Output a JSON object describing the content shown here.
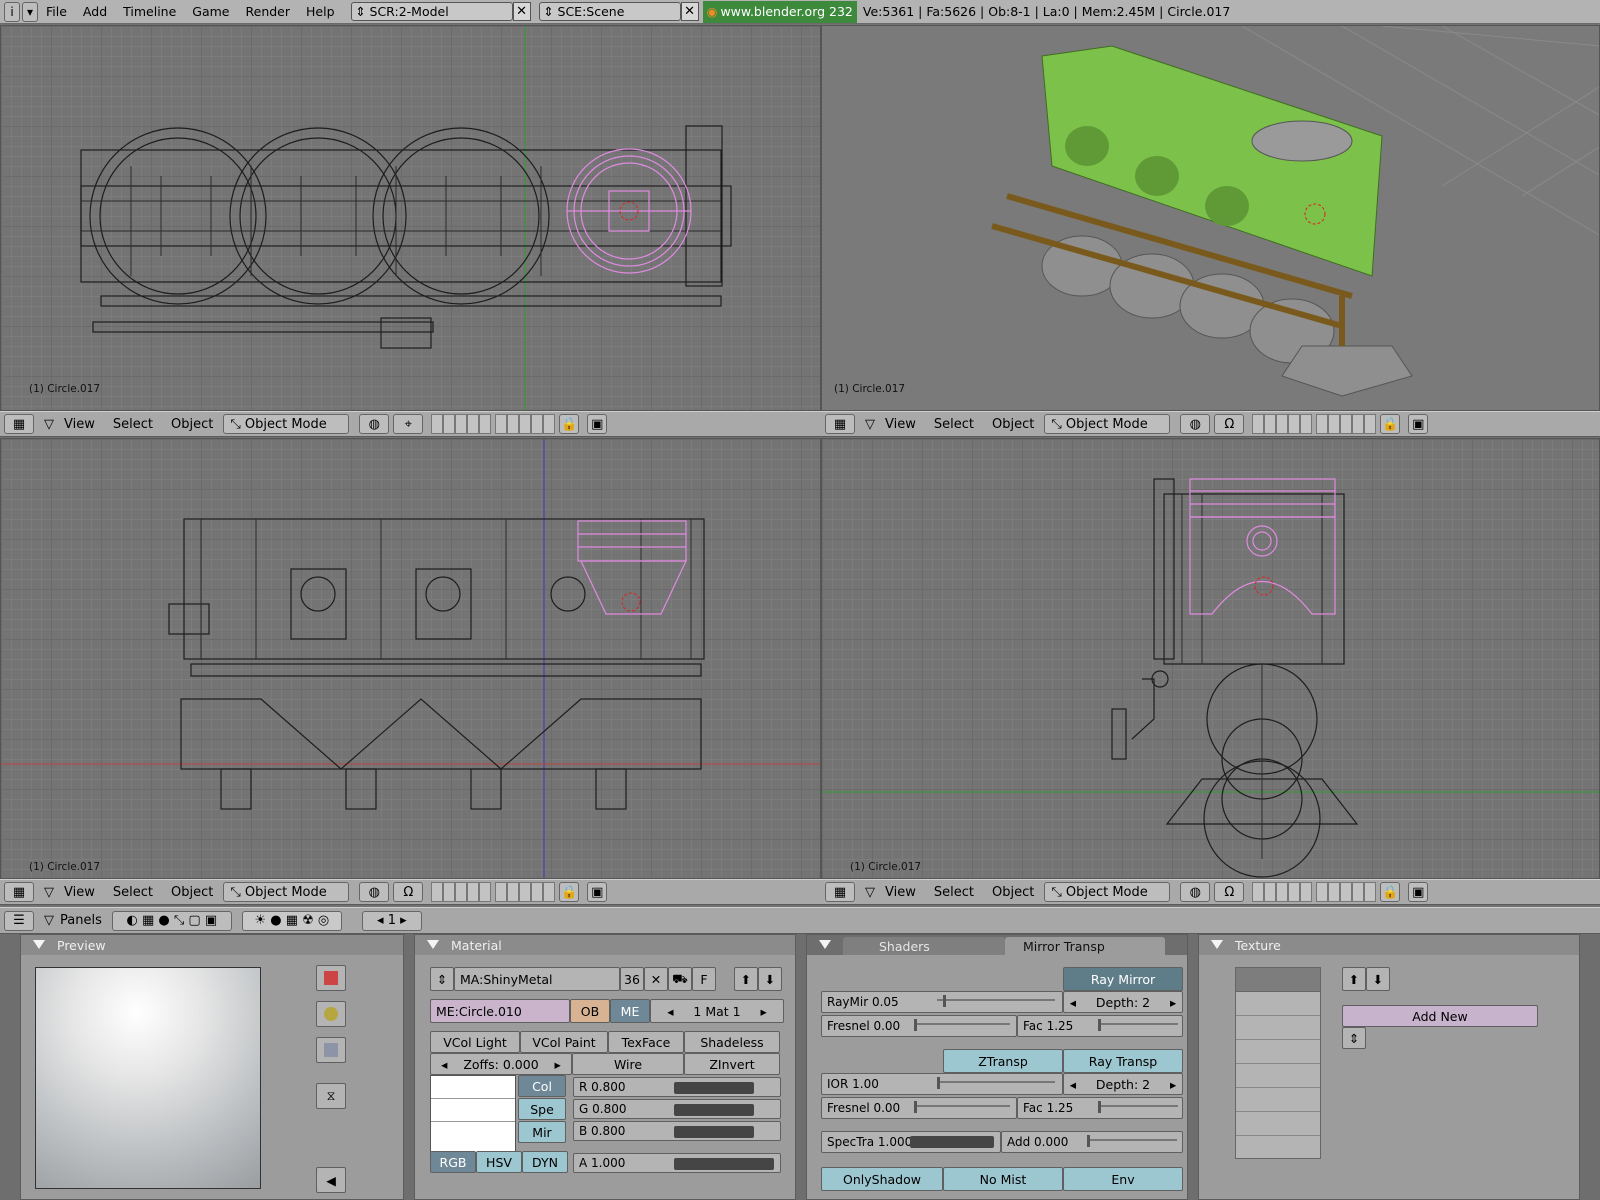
{
  "topbar": {
    "menus": [
      "File",
      "Add",
      "Timeline",
      "Game",
      "Render",
      "Help"
    ],
    "screen": "SCR:2-Model",
    "scene": "SCE:Scene",
    "website": "www.blender.org 232",
    "stats": "Ve:5361 | Fa:5626 | Ob:8-1 | La:0 | Mem:2.45M | Circle.017"
  },
  "viewports": {
    "label": "(1) Circle.017",
    "menus": [
      "View",
      "Select",
      "Object"
    ],
    "mode": "Object Mode"
  },
  "buttons_header": {
    "panels_label": "Panels",
    "frame": "1"
  },
  "preview": {
    "title": "Preview"
  },
  "material": {
    "title": "Material",
    "name": "MA:ShinyMetal",
    "users": "36",
    "f_label": "F",
    "mesh": "ME:Circle.010",
    "ob": "OB",
    "me": "ME",
    "mat_index": "1 Mat 1",
    "toggles": [
      "VCol Light",
      "VCol Paint",
      "TexFace",
      "Shadeless"
    ],
    "zoffs": "Zoffs: 0.000",
    "wire": "Wire",
    "zinvert": "ZInvert",
    "color_tabs": [
      "Col",
      "Spe",
      "Mir"
    ],
    "r": "R 0.800",
    "g": "G 0.800",
    "b": "B 0.800",
    "a": "A 1.000",
    "r_val": 0.8,
    "g_val": 0.8,
    "b_val": 0.8,
    "a_val": 1.0,
    "modes": [
      "RGB",
      "HSV",
      "DYN"
    ]
  },
  "shaders": {
    "tab_shaders": "Shaders",
    "tab_mirror": "Mirror Transp",
    "ray_mirror": "Ray Mirror",
    "raymir": "RayMir 0.05",
    "depth1": "Depth: 2",
    "fresnel1": "Fresnel 0.00",
    "fac1": "Fac 1.25",
    "ztransp": "ZTransp",
    "ray_transp": "Ray Transp",
    "ior": "IOR 1.00",
    "depth2": "Depth: 2",
    "fresnel2": "Fresnel 0.00",
    "fac2": "Fac 1.25",
    "spectra": "SpecTra 1.000",
    "spectra_val": 1.0,
    "add": "Add 0.000",
    "bottom_buttons": [
      "OnlyShadow",
      "No Mist",
      "Env"
    ]
  },
  "texture": {
    "title": "Texture",
    "add_new": "Add New"
  },
  "colors": {
    "accent_green": "#3d8a3d",
    "selected_wire": "#e08be0",
    "piston_green": "#7cc24a"
  }
}
